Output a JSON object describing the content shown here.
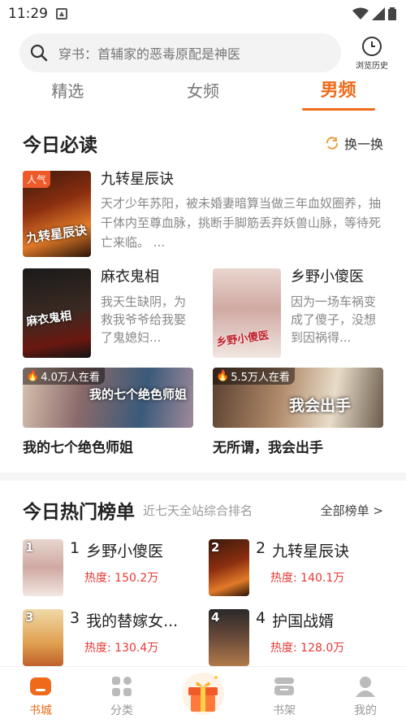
{
  "status": {
    "time": "11:29"
  },
  "search": {
    "placeholder": "穿书：首辅家的恶毒原配是神医",
    "history_label": "浏览历史"
  },
  "tabs": [
    {
      "label": "精选"
    },
    {
      "label": "女频"
    },
    {
      "label": "男频"
    }
  ],
  "today": {
    "title": "今日必读",
    "refresh_label": "换一换",
    "featured": {
      "tag": "人气",
      "cover_art": "九转星辰诀",
      "title": "九转星辰诀",
      "desc": "天才少年苏阳，被未婚妻暗算当做三年血奴圈养，抽干体内至尊血脉，挑断手脚筋丢弃妖兽山脉，等待死亡来临。 ..."
    },
    "books": [
      {
        "title": "麻衣鬼相",
        "desc": "我天生缺阴，为救我爷爷给我娶了鬼媳妇...",
        "cover_art": "麻衣鬼相"
      },
      {
        "title": "乡野小傻医",
        "desc": "因为一场车祸变成了傻子，没想到因祸得...",
        "cover_art": "乡野小傻医"
      }
    ],
    "banners": [
      {
        "viewers": "4.0万人在看",
        "art": "我的七个绝色师姐",
        "title": "我的七个绝色师姐"
      },
      {
        "viewers": "5.5万人在看",
        "art": "我会出手",
        "title": "无所谓，我会出手"
      }
    ]
  },
  "ranking": {
    "title": "今日热门榜单",
    "subtitle": "近七天全站综合排名",
    "all_label": "全部榜单 >",
    "items": [
      {
        "rank": "1",
        "title": "乡野小傻医",
        "heat": "热度: 150.2万"
      },
      {
        "rank": "2",
        "title": "九转星辰诀",
        "heat": "热度: 140.1万"
      },
      {
        "rank": "3",
        "title": "我的替嫁女...",
        "heat": "热度: 130.4万"
      },
      {
        "rank": "4",
        "title": "护国战婿",
        "heat": "热度: 128.0万"
      }
    ]
  },
  "nav": [
    {
      "label": "书城"
    },
    {
      "label": "分类"
    },
    {
      "label": "书架"
    },
    {
      "label": "我的"
    }
  ],
  "colors": {
    "accent": "#ef6a1a",
    "heat": "#e53935"
  }
}
